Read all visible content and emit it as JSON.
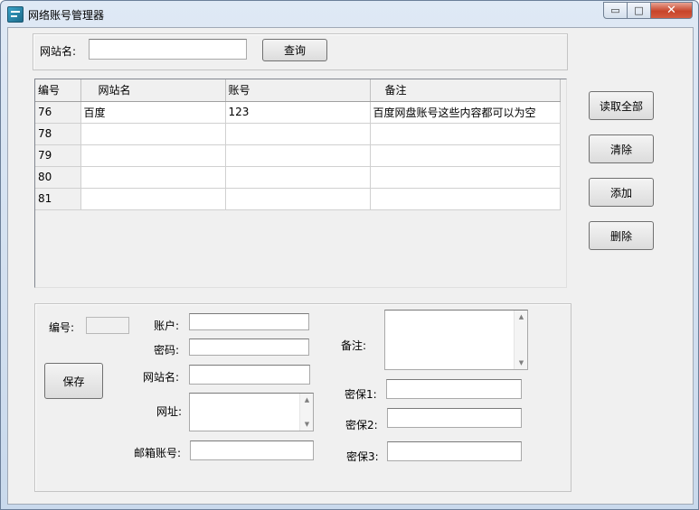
{
  "window": {
    "title": "网络账号管理器",
    "min_symbol": "▭",
    "max_symbol": "□",
    "close_symbol": "✕"
  },
  "search": {
    "label": "网站名:",
    "value": "",
    "button": "查询"
  },
  "grid": {
    "columns": [
      "编号",
      "网站名",
      "账号",
      "备注"
    ],
    "rows": [
      [
        "76",
        "百度",
        "123",
        "百度网盘账号这些内容都可以为空"
      ],
      [
        "78",
        "",
        "",
        ""
      ],
      [
        "79",
        "",
        "",
        ""
      ],
      [
        "80",
        "",
        "",
        ""
      ],
      [
        "81",
        "",
        "",
        ""
      ]
    ]
  },
  "side_buttons": {
    "read_all": "读取全部",
    "clear": "清除",
    "add": "添加",
    "delete": "删除"
  },
  "form": {
    "id_label": "编号:",
    "id_value": "",
    "save_button": "保存",
    "account_label": "账户:",
    "password_label": "密码:",
    "site_name_label": "网站名:",
    "url_label": "网址:",
    "email_label": "邮箱账号:",
    "note_label": "备注:",
    "secret1_label": "密保1:",
    "secret2_label": "密保2:",
    "secret3_label": "密保3:",
    "scroll_up": "▲",
    "scroll_down": "▼"
  }
}
